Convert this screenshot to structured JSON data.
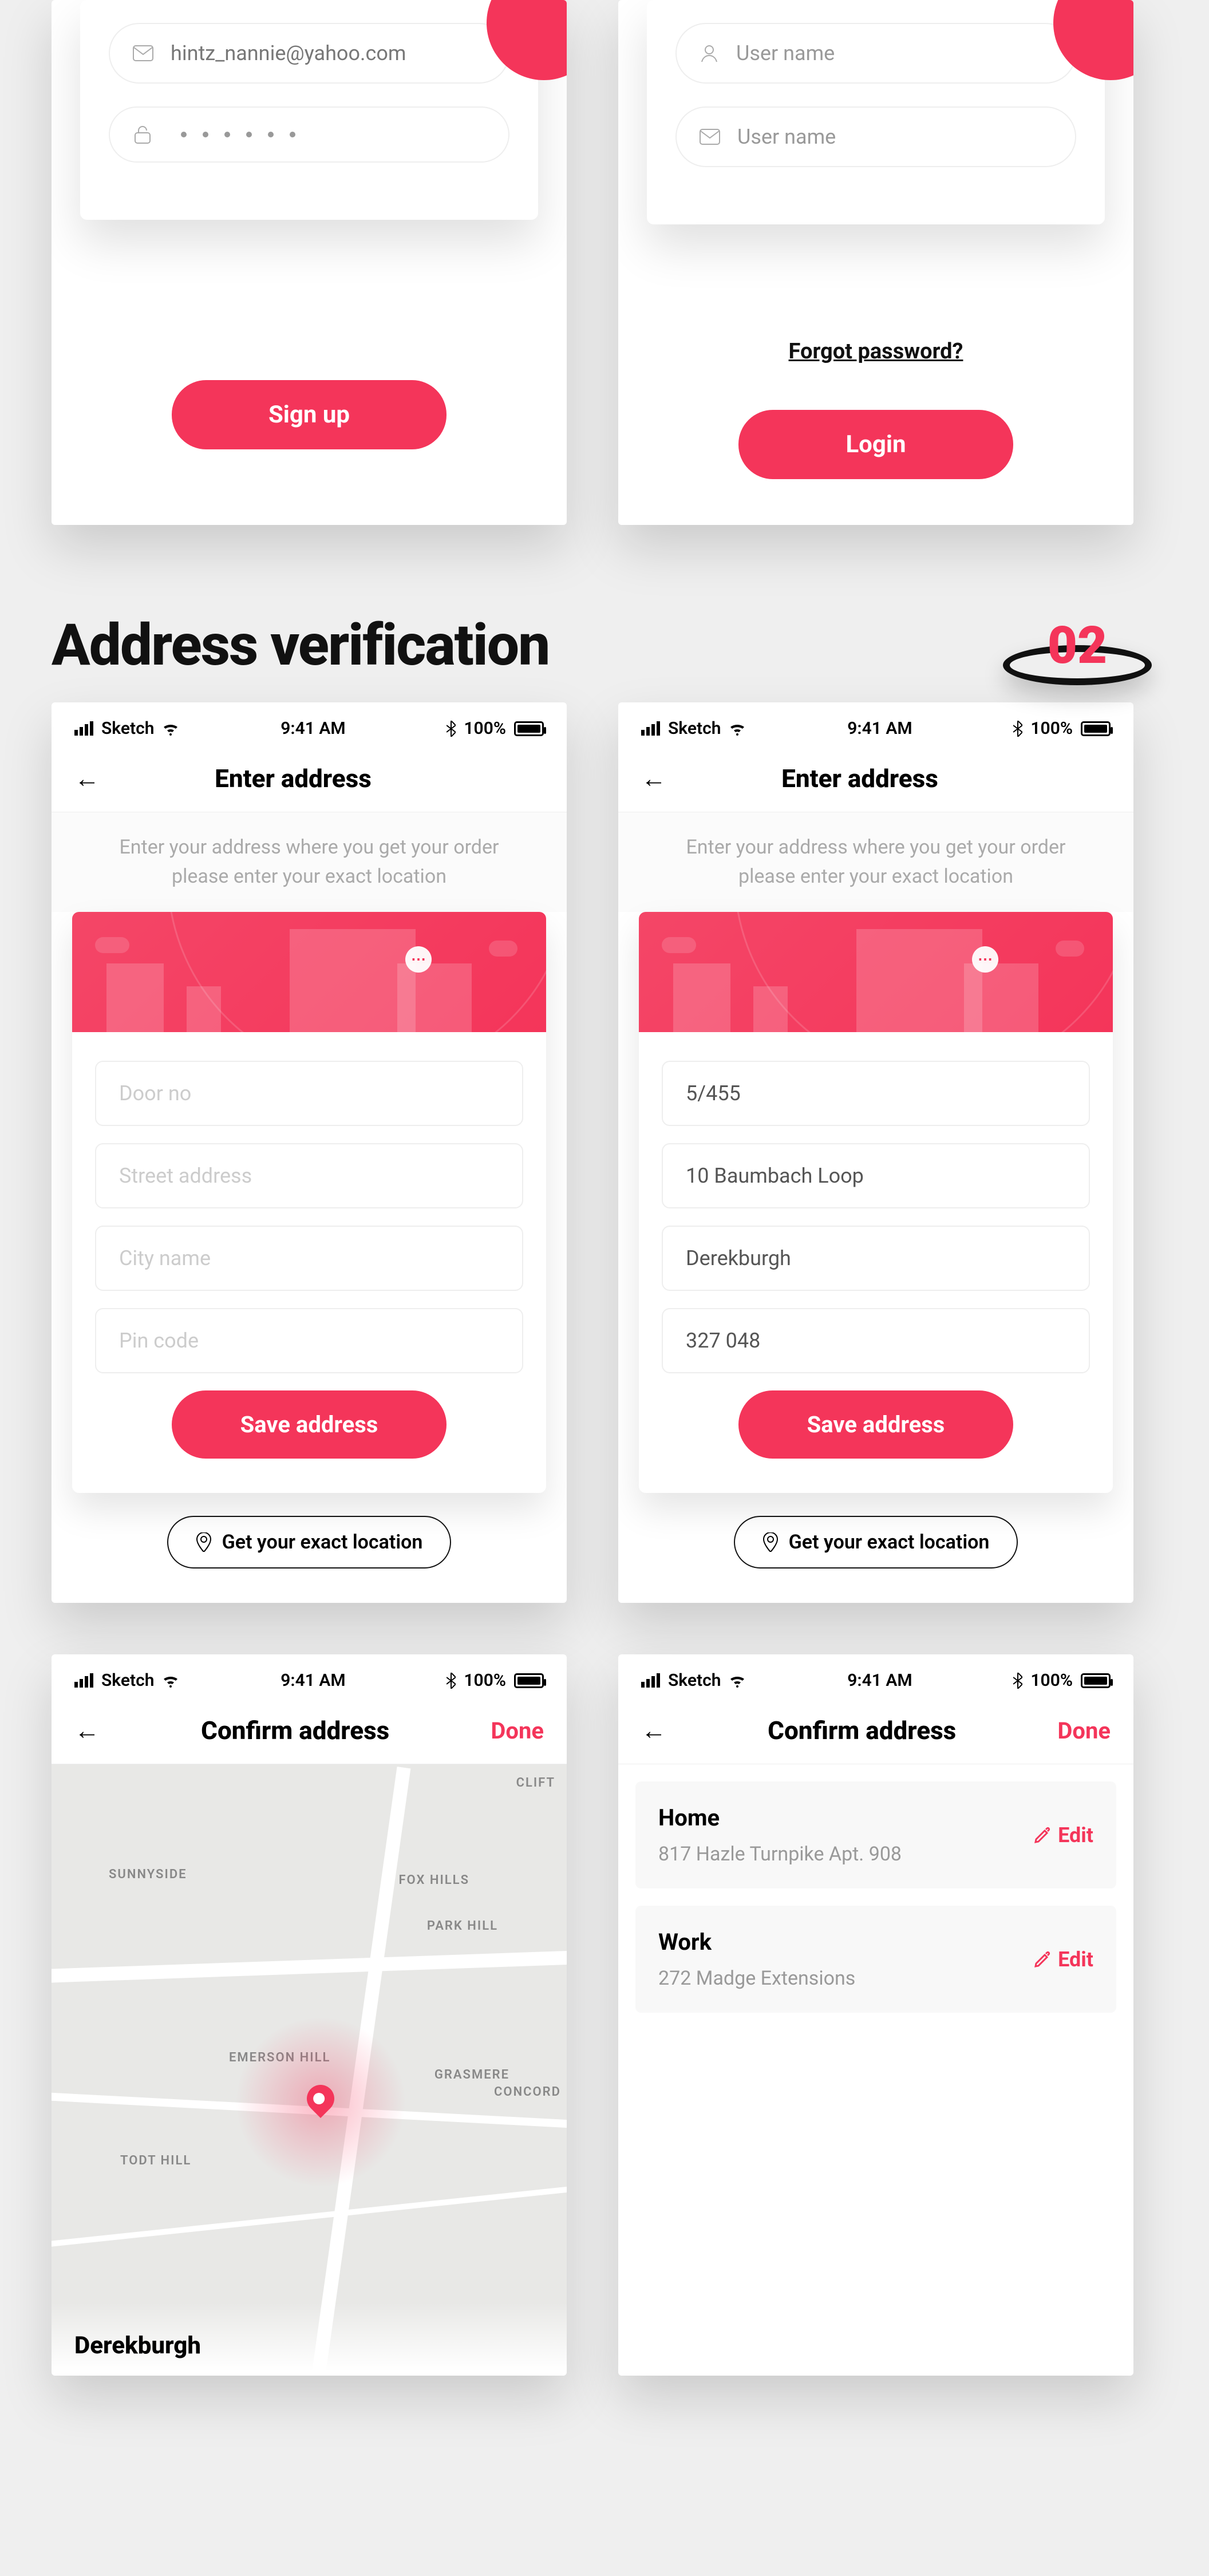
{
  "colors": {
    "accent": "#f4355a"
  },
  "statusbar": {
    "carrier": "Sketch",
    "time": "9:41 AM",
    "battery": "100%"
  },
  "auth_left": {
    "email": "hintz_nannie@yahoo.com",
    "button": "Sign up"
  },
  "auth_right": {
    "field1_placeholder": "User name",
    "field2_placeholder": "User name",
    "forgot": "Forgot password?",
    "button": "Login"
  },
  "section2": {
    "title": "Address verification",
    "num": "02"
  },
  "enter_addr": {
    "title": "Enter address",
    "subtitle": "Enter your address where you get your order please enter your exact location",
    "placeholders": {
      "door": "Door no",
      "street": "Street address",
      "city": "City name",
      "pin": "Pin code"
    },
    "values": {
      "door": "5/455",
      "street": "10 Baumbach Loop",
      "city": "Derekburgh",
      "pin": "327 048"
    },
    "save": "Save address",
    "get_location": "Get your exact location"
  },
  "confirm": {
    "title": "Confirm address",
    "done": "Done",
    "map_labels": {
      "l1": "CLIFT",
      "l2": "FOX HILLS",
      "l3": "SUNNYSIDE",
      "l4": "PARK HILL",
      "l5": "EMERSON HILL",
      "l6": "GRASMERE",
      "l7": "CONCORD",
      "l8": "TODT HILL"
    },
    "city": "Derekburgh",
    "addresses": [
      {
        "label": "Home",
        "addr": "817 Hazle Turnpike Apt. 908",
        "edit": "Edit"
      },
      {
        "label": "Work",
        "addr": "272 Madge Extensions",
        "edit": "Edit"
      }
    ]
  }
}
